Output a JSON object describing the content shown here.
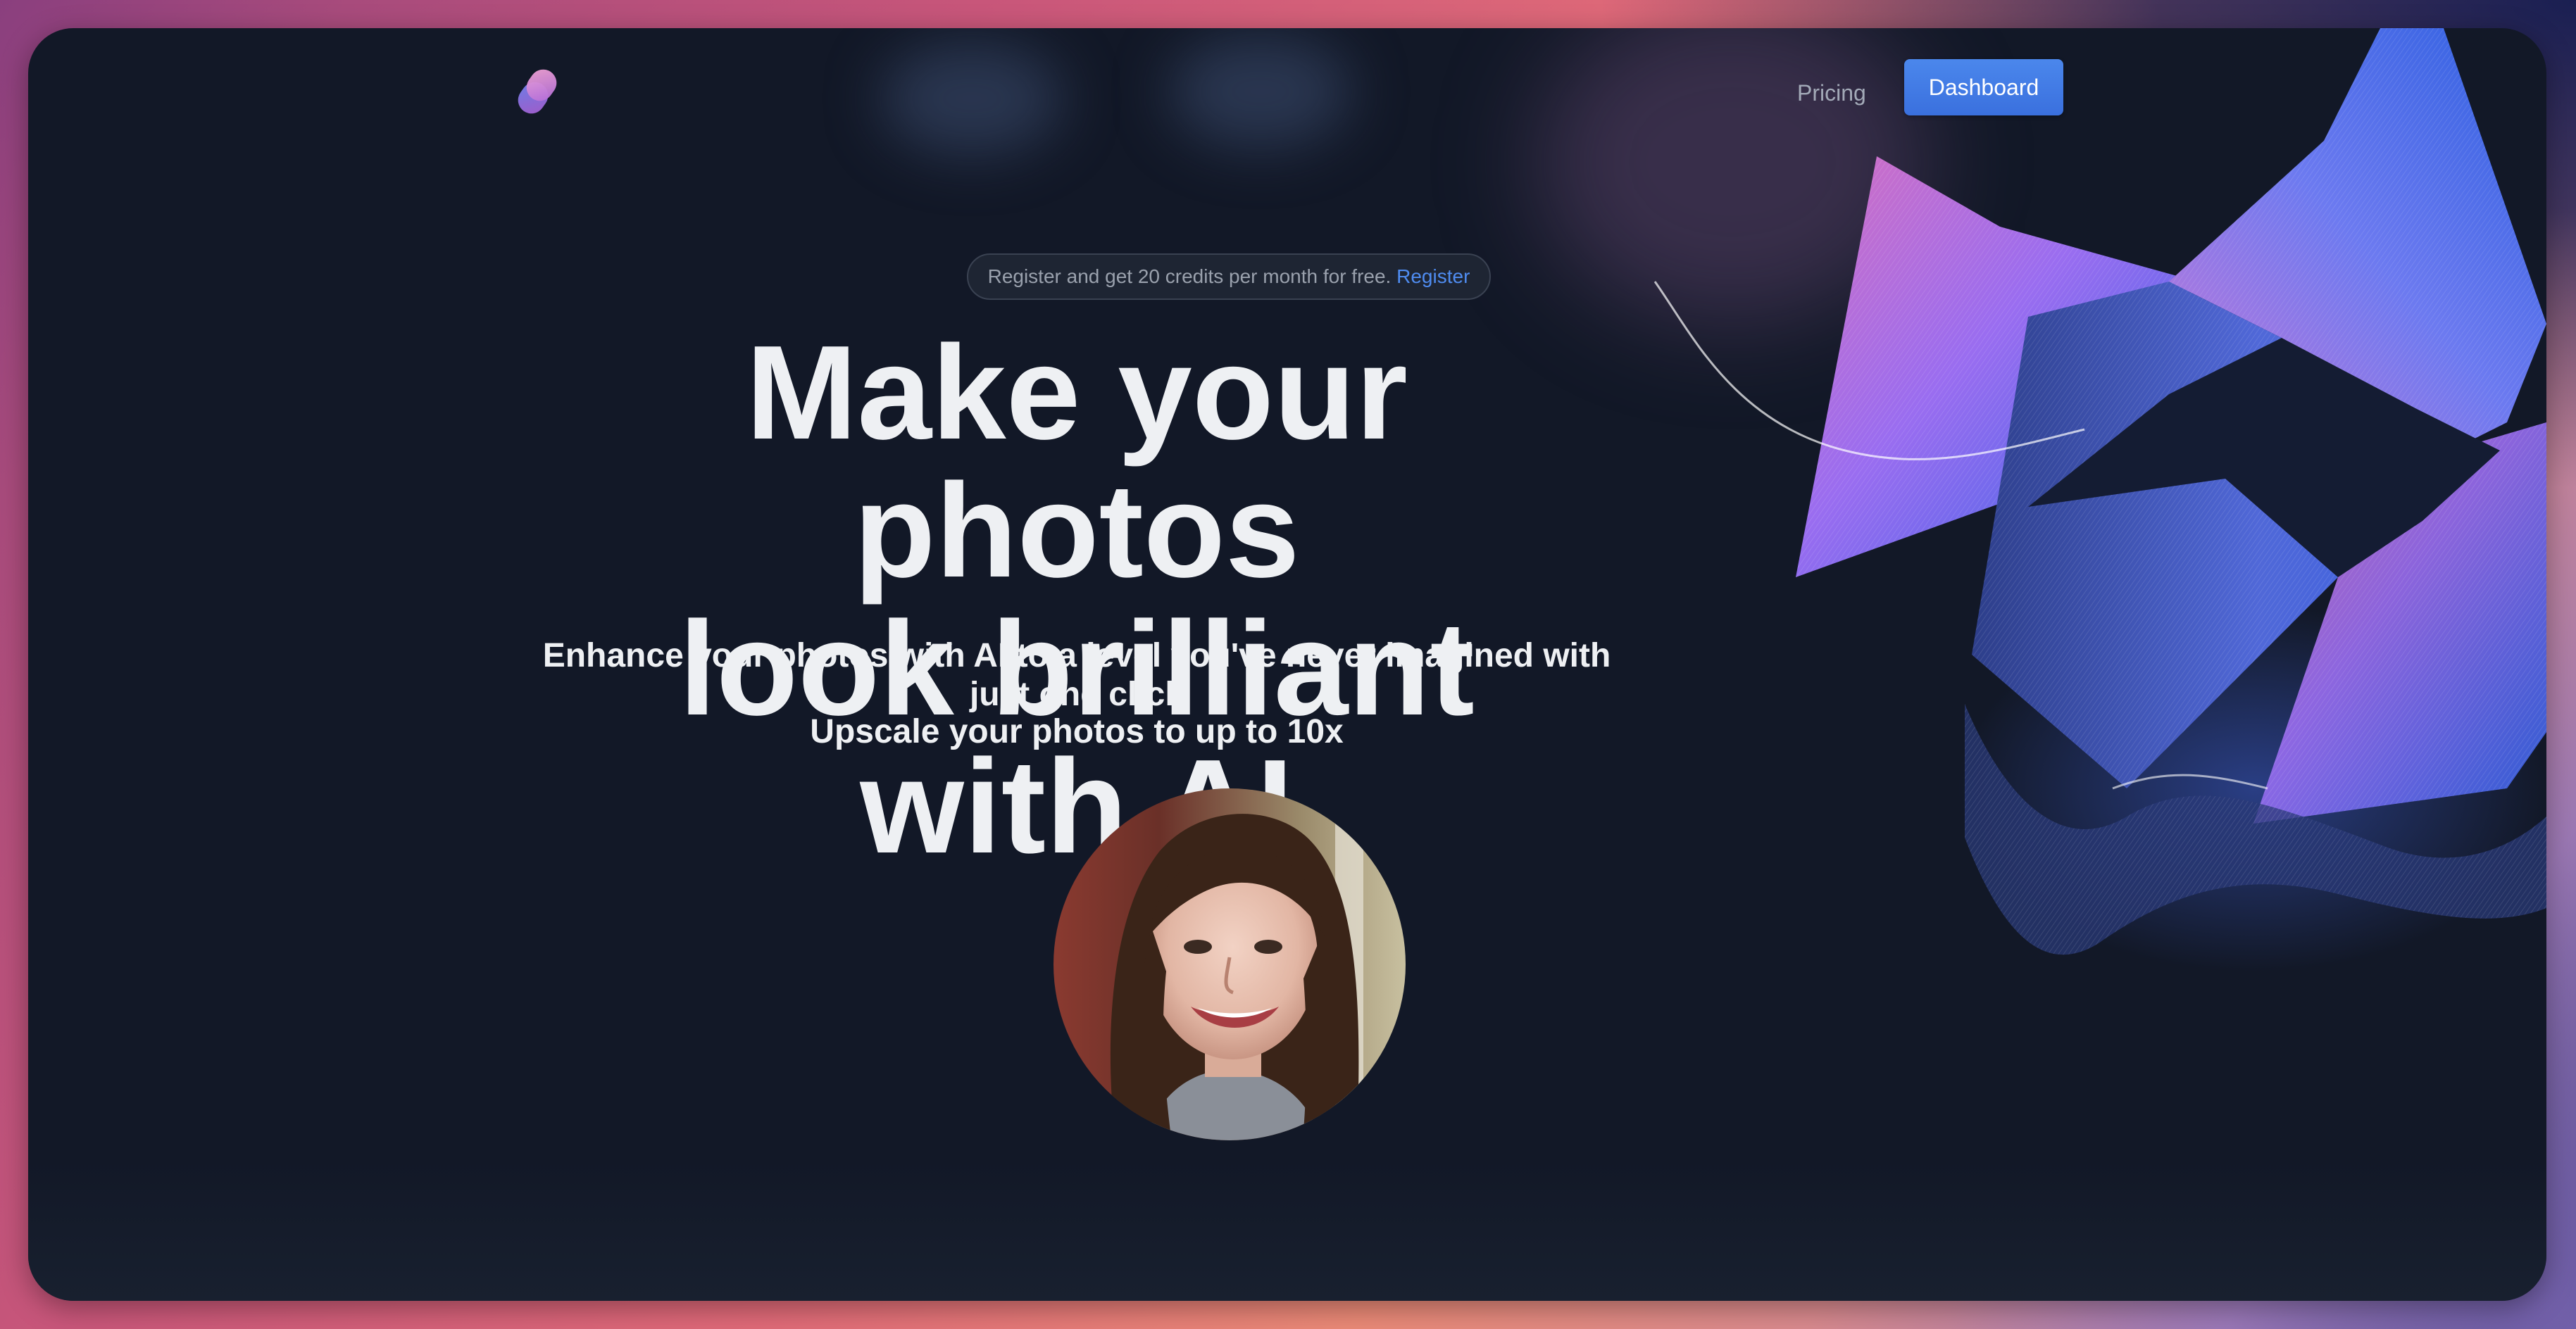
{
  "nav": {
    "pricing_label": "Pricing",
    "dashboard_label": "Dashboard"
  },
  "banner": {
    "text": "Register and get 20 credits per month for free.",
    "link_label": "Register"
  },
  "hero": {
    "headline_line1": "Make your photos",
    "headline_line2": "look brilliant with AI",
    "subtitle": "Enhance your photos with AI to a level you've never imagined with just one click",
    "tagline": "Upscale your photos to up to 10x"
  },
  "icons": {
    "logo": "logo-icon"
  },
  "colors": {
    "frame_bg": "#121827",
    "accent_blue": "#3a70de",
    "link_blue": "#4f8cf0",
    "heading_text": "#eef0f3",
    "muted_text": "#a3aab8"
  }
}
